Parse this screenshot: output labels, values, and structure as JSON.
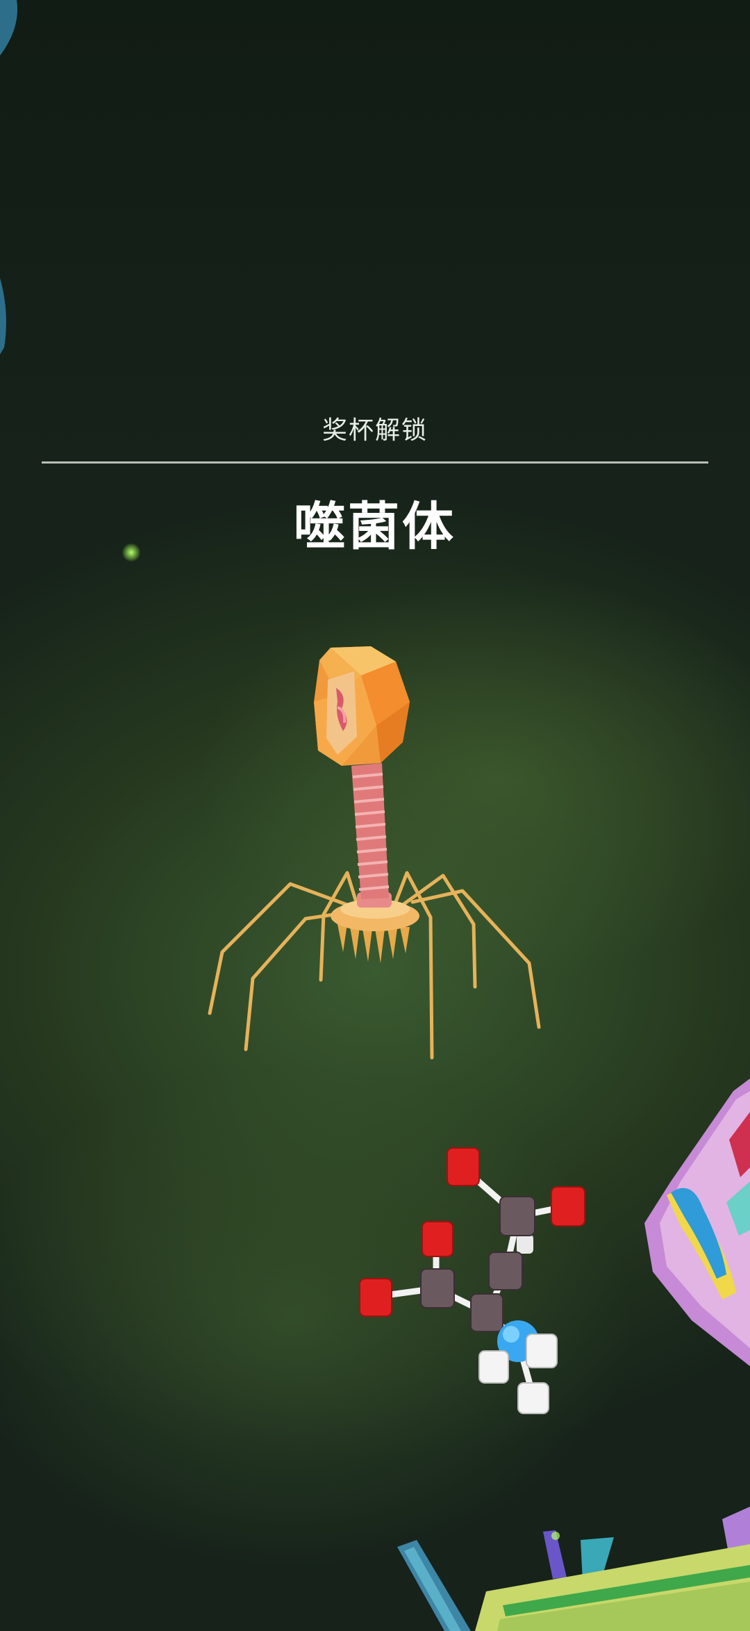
{
  "trophy": {
    "subtitle": "奖杯解锁",
    "name": "噬菌体"
  },
  "colors": {
    "background": "#2e4a28",
    "phage_head": "#f0983a",
    "phage_tail": "#e07878",
    "phage_legs": "#e6b25a",
    "molecule_oxygen": "#e02020",
    "molecule_carbon": "#6a5a60",
    "molecule_nitrogen": "#3aa8f0",
    "molecule_hydrogen": "#f4f4f4"
  }
}
